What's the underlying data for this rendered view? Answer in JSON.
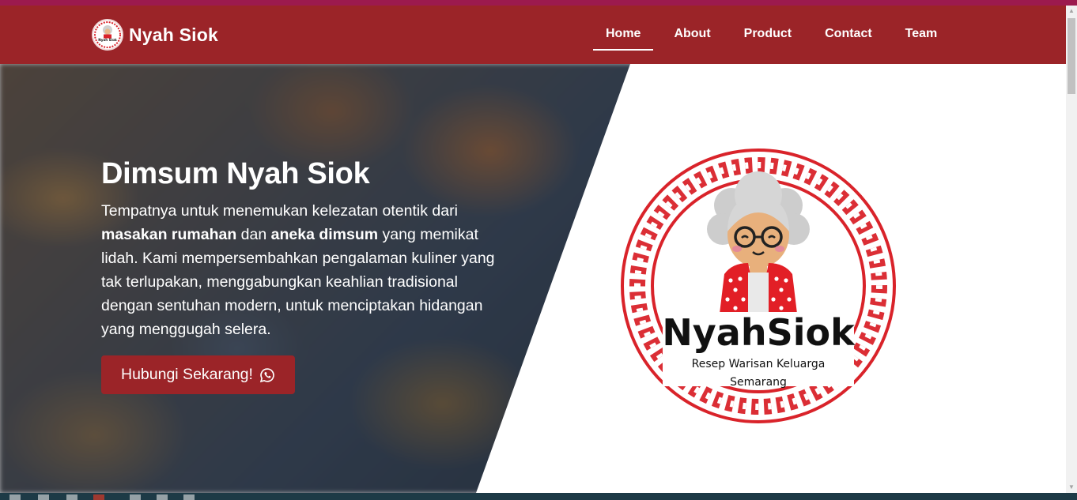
{
  "brand": {
    "name": "Nyah Siok"
  },
  "nav": {
    "items": [
      {
        "label": "Home",
        "active": true
      },
      {
        "label": "About"
      },
      {
        "label": "Product"
      },
      {
        "label": "Contact"
      },
      {
        "label": "Team"
      }
    ]
  },
  "hero": {
    "title": "Dimsum Nyah Siok",
    "description": {
      "part1": "Tempatnya untuk menemukan kelezatan otentik dari ",
      "bold1": "masakan rumahan",
      "part2": " dan ",
      "bold2": "aneka dimsum",
      "part3": " yang memikat lidah. Kami mempersembahkan pengalaman kuliner yang tak terlupakan, menggabungkan keahlian tradisional dengan sentuhan modern, untuk menciptakan hidangan yang menggugah selera."
    },
    "cta_label": "Hubungi Sekarang!",
    "cta_icon": "whatsapp-icon"
  },
  "logo": {
    "name_text": "NyahSiok",
    "tagline1": "Resep Warisan Keluarga",
    "tagline2": "Semarang"
  },
  "colors": {
    "primary": "#9b2428",
    "top_strip": "#9c1a4e",
    "logo_red": "#d9232a"
  }
}
